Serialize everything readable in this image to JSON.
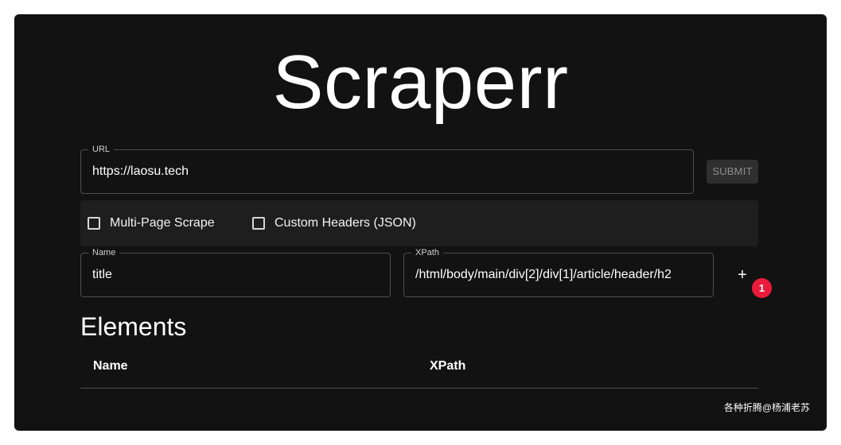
{
  "app": {
    "title": "Scraperr"
  },
  "url_field": {
    "label": "URL",
    "value": "https://laosu.tech"
  },
  "submit": {
    "label": "SUBMIT"
  },
  "options": {
    "multi_page_label": "Multi-Page Scrape",
    "multi_page_checked": false,
    "custom_headers_label": "Custom Headers (JSON)",
    "custom_headers_checked": false
  },
  "name_field": {
    "label": "Name",
    "value": "title"
  },
  "xpath_field": {
    "label": "XPath",
    "value": "/html/body/main/div[2]/div[1]/article/header/h2"
  },
  "add_button": {
    "icon": "plus-icon",
    "symbol": "+"
  },
  "badge": {
    "count": "1"
  },
  "elements_section": {
    "title": "Elements",
    "columns": [
      "Name",
      "XPath"
    ]
  },
  "watermark": {
    "text": "各种折腾@杨浦老苏"
  },
  "colors": {
    "background": "#121212",
    "panel": "#1e1e1e",
    "border": "#4d4d4d",
    "badge": "#ea1b3a",
    "text": "#ffffff"
  }
}
